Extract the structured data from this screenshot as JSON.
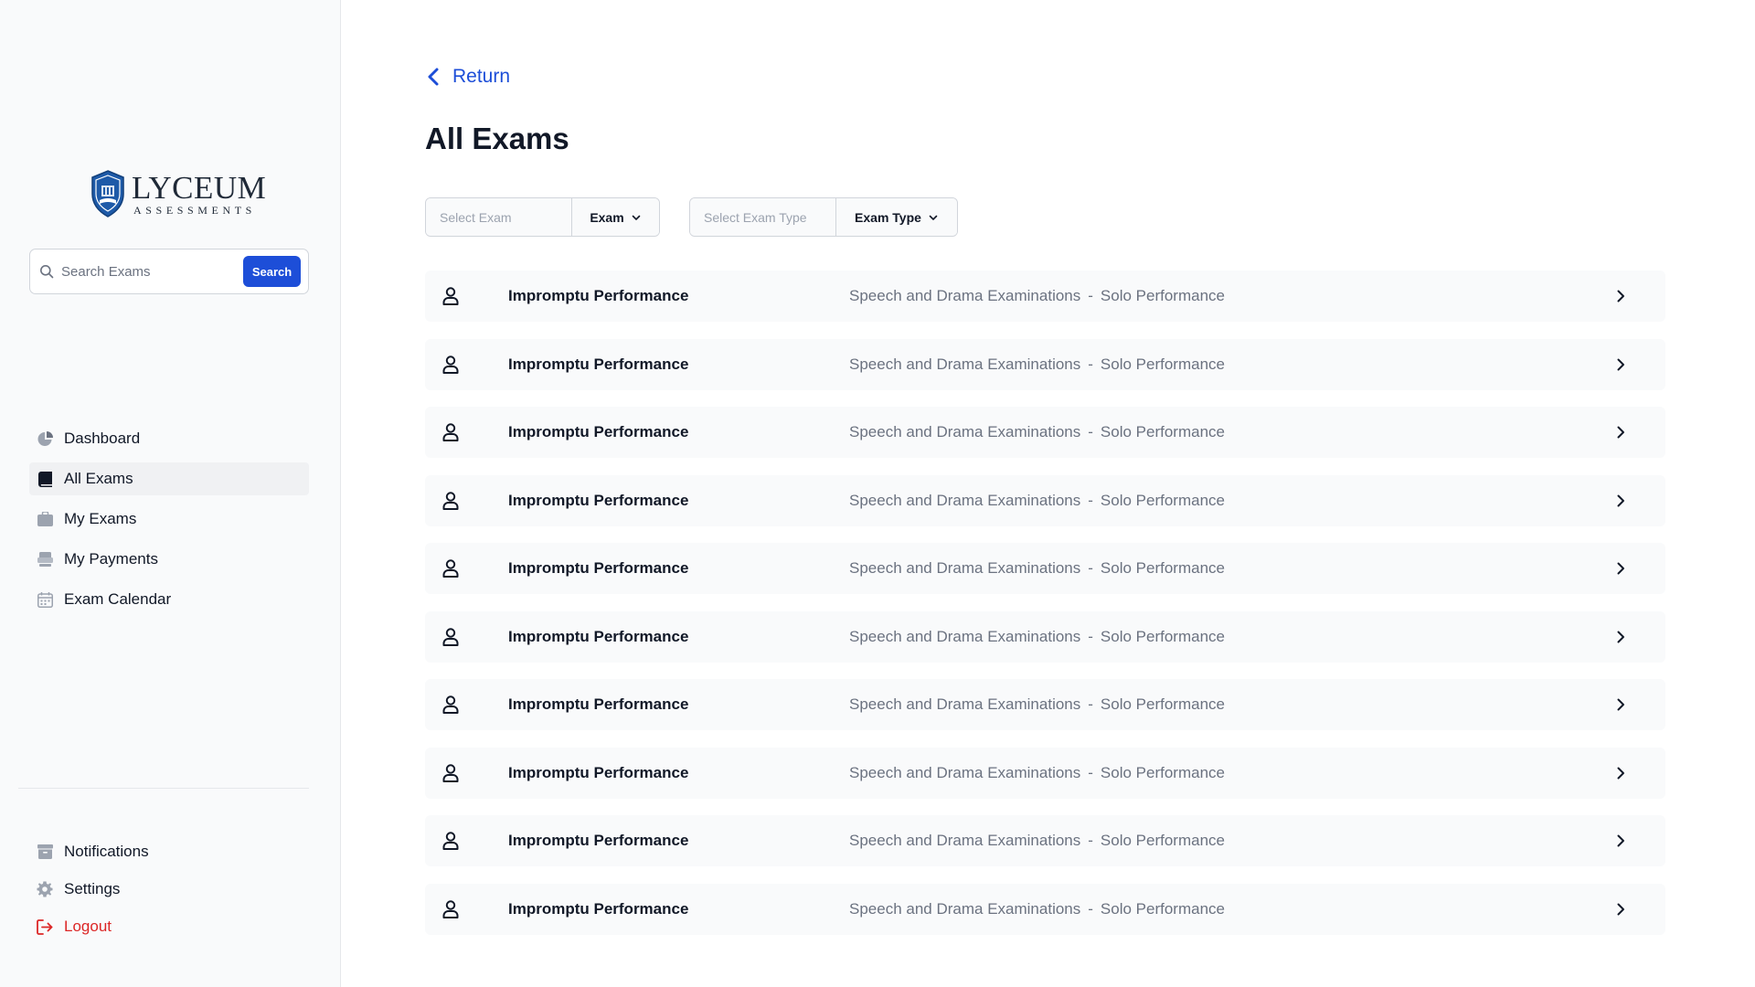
{
  "brand": {
    "name": "LYCEUM",
    "subtitle": "ASSESSMENTS",
    "color": "#1e5aa8"
  },
  "search": {
    "placeholder": "Search Exams",
    "button_label": "Search"
  },
  "nav": {
    "items": [
      {
        "label": "Dashboard",
        "icon": "pie-chart-icon",
        "active": false
      },
      {
        "label": "All Exams",
        "icon": "book-icon",
        "active": true
      },
      {
        "label": "My Exams",
        "icon": "briefcase-icon",
        "active": false
      },
      {
        "label": "My Payments",
        "icon": "payments-icon",
        "active": false
      },
      {
        "label": "Exam Calendar",
        "icon": "calendar-icon",
        "active": false
      }
    ],
    "bottom_items": [
      {
        "label": "Notifications",
        "icon": "archive-icon"
      },
      {
        "label": "Settings",
        "icon": "gear-icon"
      },
      {
        "label": "Logout",
        "icon": "logout-icon"
      }
    ]
  },
  "main": {
    "return_label": "Return",
    "title": "All Exams",
    "filters": {
      "exam": {
        "placeholder": "Select Exam",
        "label": "Exam"
      },
      "exam_type": {
        "placeholder": "Select Exam Type",
        "label": "Exam Type"
      }
    },
    "exams": [
      {
        "name": "Impromptu Performance",
        "category": "Speech and Drama Examinations",
        "separator": "-",
        "type": "Solo Performance"
      },
      {
        "name": "Impromptu Performance",
        "category": "Speech and Drama Examinations",
        "separator": "-",
        "type": "Solo Performance"
      },
      {
        "name": "Impromptu Performance",
        "category": "Speech and Drama Examinations",
        "separator": "-",
        "type": "Solo Performance"
      },
      {
        "name": "Impromptu Performance",
        "category": "Speech and Drama Examinations",
        "separator": "-",
        "type": "Solo Performance"
      },
      {
        "name": "Impromptu Performance",
        "category": "Speech and Drama Examinations",
        "separator": "-",
        "type": "Solo Performance"
      },
      {
        "name": "Impromptu Performance",
        "category": "Speech and Drama Examinations",
        "separator": "-",
        "type": "Solo Performance"
      },
      {
        "name": "Impromptu Performance",
        "category": "Speech and Drama Examinations",
        "separator": "-",
        "type": "Solo Performance"
      },
      {
        "name": "Impromptu Performance",
        "category": "Speech and Drama Examinations",
        "separator": "-",
        "type": "Solo Performance"
      },
      {
        "name": "Impromptu Performance",
        "category": "Speech and Drama Examinations",
        "separator": "-",
        "type": "Solo Performance"
      },
      {
        "name": "Impromptu Performance",
        "category": "Speech and Drama Examinations",
        "separator": "-",
        "type": "Solo Performance"
      }
    ]
  },
  "colors": {
    "accent": "#1d4ed8",
    "logout": "#dc2626",
    "sidebar_bg": "#f9fafb",
    "row_bg": "#f9fafb"
  }
}
